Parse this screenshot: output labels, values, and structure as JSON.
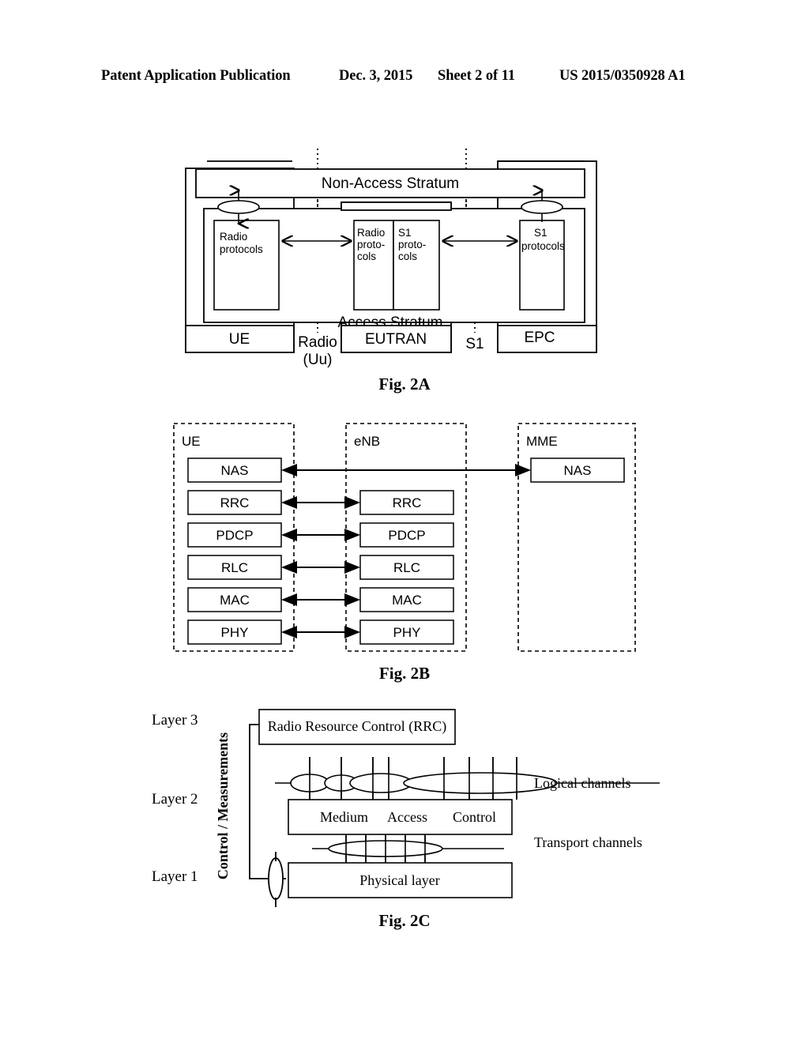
{
  "header": {
    "title": "Patent Application Publication",
    "date": "Dec. 3, 2015",
    "sheet": "Sheet 2 of 11",
    "publication_number": "US 2015/0350928 A1"
  },
  "figures": {
    "fig2a": {
      "caption": "Fig. 2A",
      "strata": {
        "non_access": "Non-Access Stratum",
        "access": "Access Stratum"
      },
      "blocks": {
        "ue_radio_protocols": "Radio\nprotocols",
        "enb_radio_protocols": "Radio\nproto-\ncols",
        "enb_s1_protocols": "S1\nproto-\ncols",
        "epc_s1_protocols": "S1\nprotocols"
      },
      "node_labels": {
        "ue": "UE",
        "eutran": "EUTRAN",
        "epc": "EPC"
      },
      "interface_labels": {
        "radio_uu_line1": "Radio",
        "radio_uu_line2": "(Uu)",
        "s1": "S1"
      }
    },
    "fig2b": {
      "caption": "Fig. 2B",
      "columns": [
        {
          "name": "UE",
          "layers": [
            "NAS",
            "RRC",
            "PDCP",
            "RLC",
            "MAC",
            "PHY"
          ]
        },
        {
          "name": "eNB",
          "layers": [
            "RRC",
            "PDCP",
            "RLC",
            "MAC",
            "PHY"
          ]
        },
        {
          "name": "MME",
          "layers": [
            "NAS"
          ]
        }
      ]
    },
    "fig2c": {
      "caption": "Fig. 2C",
      "layer_labels": [
        "Layer 3",
        "Layer 2",
        "Layer 1"
      ],
      "vertical_label": "Control / Measurements",
      "blocks": {
        "rrc": "Radio Resource Control (RRC)",
        "mac_word1": "Medium",
        "mac_word2": "Access",
        "mac_word3": "Control",
        "phy": "Physical layer"
      },
      "channel_labels": {
        "logical": "Logical channels",
        "transport": "Transport channels"
      }
    }
  },
  "colors": {
    "ink": "#000000",
    "paper": "#ffffff"
  }
}
